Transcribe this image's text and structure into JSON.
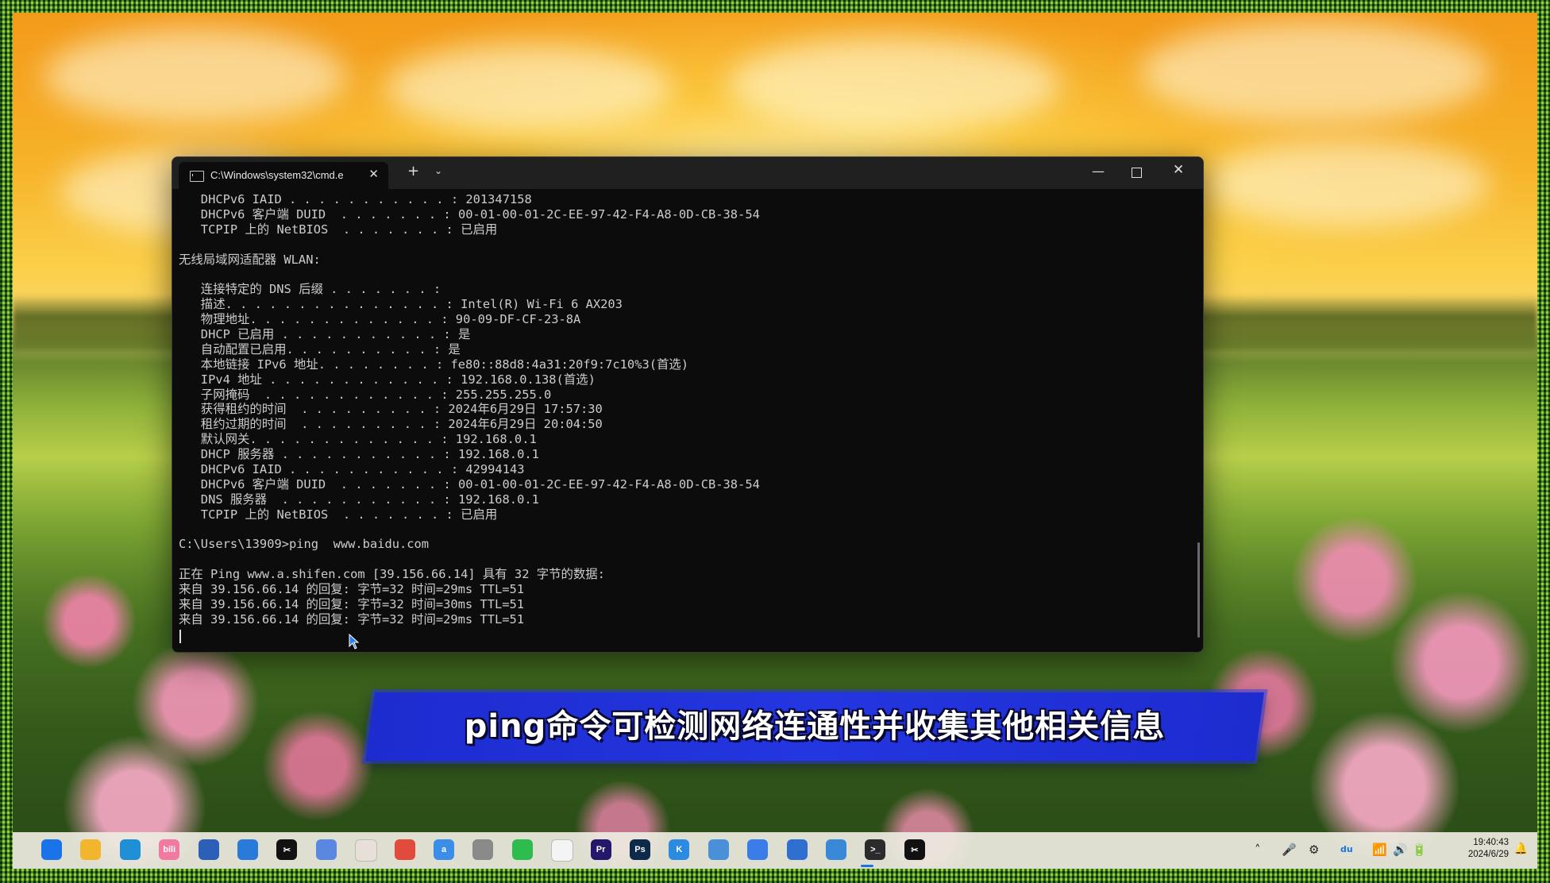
{
  "window": {
    "tab_title": "C:\\Windows\\system32\\cmd.e",
    "tab_close": "✕",
    "new_tab": "+",
    "dropdown": "⌄",
    "minimize": "—",
    "close": "✕"
  },
  "console_lines": [
    "   DHCPv6 IAID . . . . . . . . . . . : 201347158",
    "   DHCPv6 客户端 DUID  . . . . . . . : 00-01-00-01-2C-EE-97-42-F4-A8-0D-CB-38-54",
    "   TCPIP 上的 NetBIOS  . . . . . . . : 已启用",
    "",
    "无线局域网适配器 WLAN:",
    "",
    "   连接特定的 DNS 后缀 . . . . . . . :",
    "   描述. . . . . . . . . . . . . . . : Intel(R) Wi-Fi 6 AX203",
    "   物理地址. . . . . . . . . . . . . : 90-09-DF-CF-23-8A",
    "   DHCP 已启用 . . . . . . . . . . . : 是",
    "   自动配置已启用. . . . . . . . . . : 是",
    "   本地链接 IPv6 地址. . . . . . . . : fe80::88d8:4a31:20f9:7c10%3(首选)",
    "   IPv4 地址 . . . . . . . . . . . . : 192.168.0.138(首选)",
    "   子网掩码  . . . . . . . . . . . . : 255.255.255.0",
    "   获得租约的时间  . . . . . . . . . : 2024年6月29日 17:57:30",
    "   租约过期的时间  . . . . . . . . . : 2024年6月29日 20:04:50",
    "   默认网关. . . . . . . . . . . . . : 192.168.0.1",
    "   DHCP 服务器 . . . . . . . . . . . : 192.168.0.1",
    "   DHCPv6 IAID . . . . . . . . . . . : 42994143",
    "   DHCPv6 客户端 DUID  . . . . . . . : 00-01-00-01-2C-EE-97-42-F4-A8-0D-CB-38-54",
    "   DNS 服务器  . . . . . . . . . . . : 192.168.0.1",
    "   TCPIP 上的 NetBIOS  . . . . . . . : 已启用",
    "",
    "C:\\Users\\13909>ping  www.baidu.com",
    "",
    "正在 Ping www.a.shifen.com [39.156.66.14] 具有 32 字节的数据:",
    "来自 39.156.66.14 的回复: 字节=32 时间=29ms TTL=51",
    "来自 39.156.66.14 的回复: 字节=32 时间=30ms TTL=51",
    "来自 39.156.66.14 的回复: 字节=32 时间=29ms TTL=51"
  ],
  "caption": "ping命令可检测网络连通性并收集其他相关信息",
  "taskbar": {
    "icons": [
      {
        "name": "start-icon",
        "label": "",
        "color": "#1a73e8"
      },
      {
        "name": "file-explorer-icon",
        "label": "",
        "color": "#f2b52c"
      },
      {
        "name": "edge-icon",
        "label": "",
        "color": "#1f8fd6"
      },
      {
        "name": "bilibili-icon",
        "label": "bili",
        "color": "#f27aa0"
      },
      {
        "name": "store-icon",
        "label": "",
        "color": "#2b5fb8"
      },
      {
        "name": "app-icon",
        "label": "",
        "color": "#2a7ad9"
      },
      {
        "name": "capcut-icon",
        "label": "✂",
        "color": "#111111"
      },
      {
        "name": "network-app-icon",
        "label": "",
        "color": "#5a88e0"
      },
      {
        "name": "photos-icon",
        "label": "",
        "color": "#e8e0d8"
      },
      {
        "name": "chrome-icon",
        "label": "",
        "color": "#e24a3b"
      },
      {
        "name": "ai-app-icon",
        "label": "a",
        "color": "#3a8ee8"
      },
      {
        "name": "game-app-icon",
        "label": "",
        "color": "#8a8a8a"
      },
      {
        "name": "wechat-icon",
        "label": "",
        "color": "#2dbd4e"
      },
      {
        "name": "document-icon",
        "label": "",
        "color": "#f4f4f4"
      },
      {
        "name": "premiere-icon",
        "label": "Pr",
        "color": "#23186a"
      },
      {
        "name": "photoshop-icon",
        "label": "Ps",
        "color": "#0e2a4a"
      },
      {
        "name": "kuwo-icon",
        "label": "K",
        "color": "#2a8be0"
      },
      {
        "name": "window-app-icon",
        "label": "",
        "color": "#4a90d8"
      },
      {
        "name": "mail-app-icon",
        "label": "",
        "color": "#3a7de8"
      },
      {
        "name": "search-app-icon",
        "label": "",
        "color": "#2f6fd0"
      },
      {
        "name": "notepad-icon",
        "label": "",
        "color": "#3a88d8"
      },
      {
        "name": "terminal-icon",
        "label": ">_",
        "color": "#2b2b2b"
      },
      {
        "name": "capcut2-icon",
        "label": "✂",
        "color": "#111111"
      }
    ],
    "tray": {
      "chevron": "˄",
      "du_label": "du",
      "time": "19:40:43",
      "date": "2024/6/29"
    }
  }
}
